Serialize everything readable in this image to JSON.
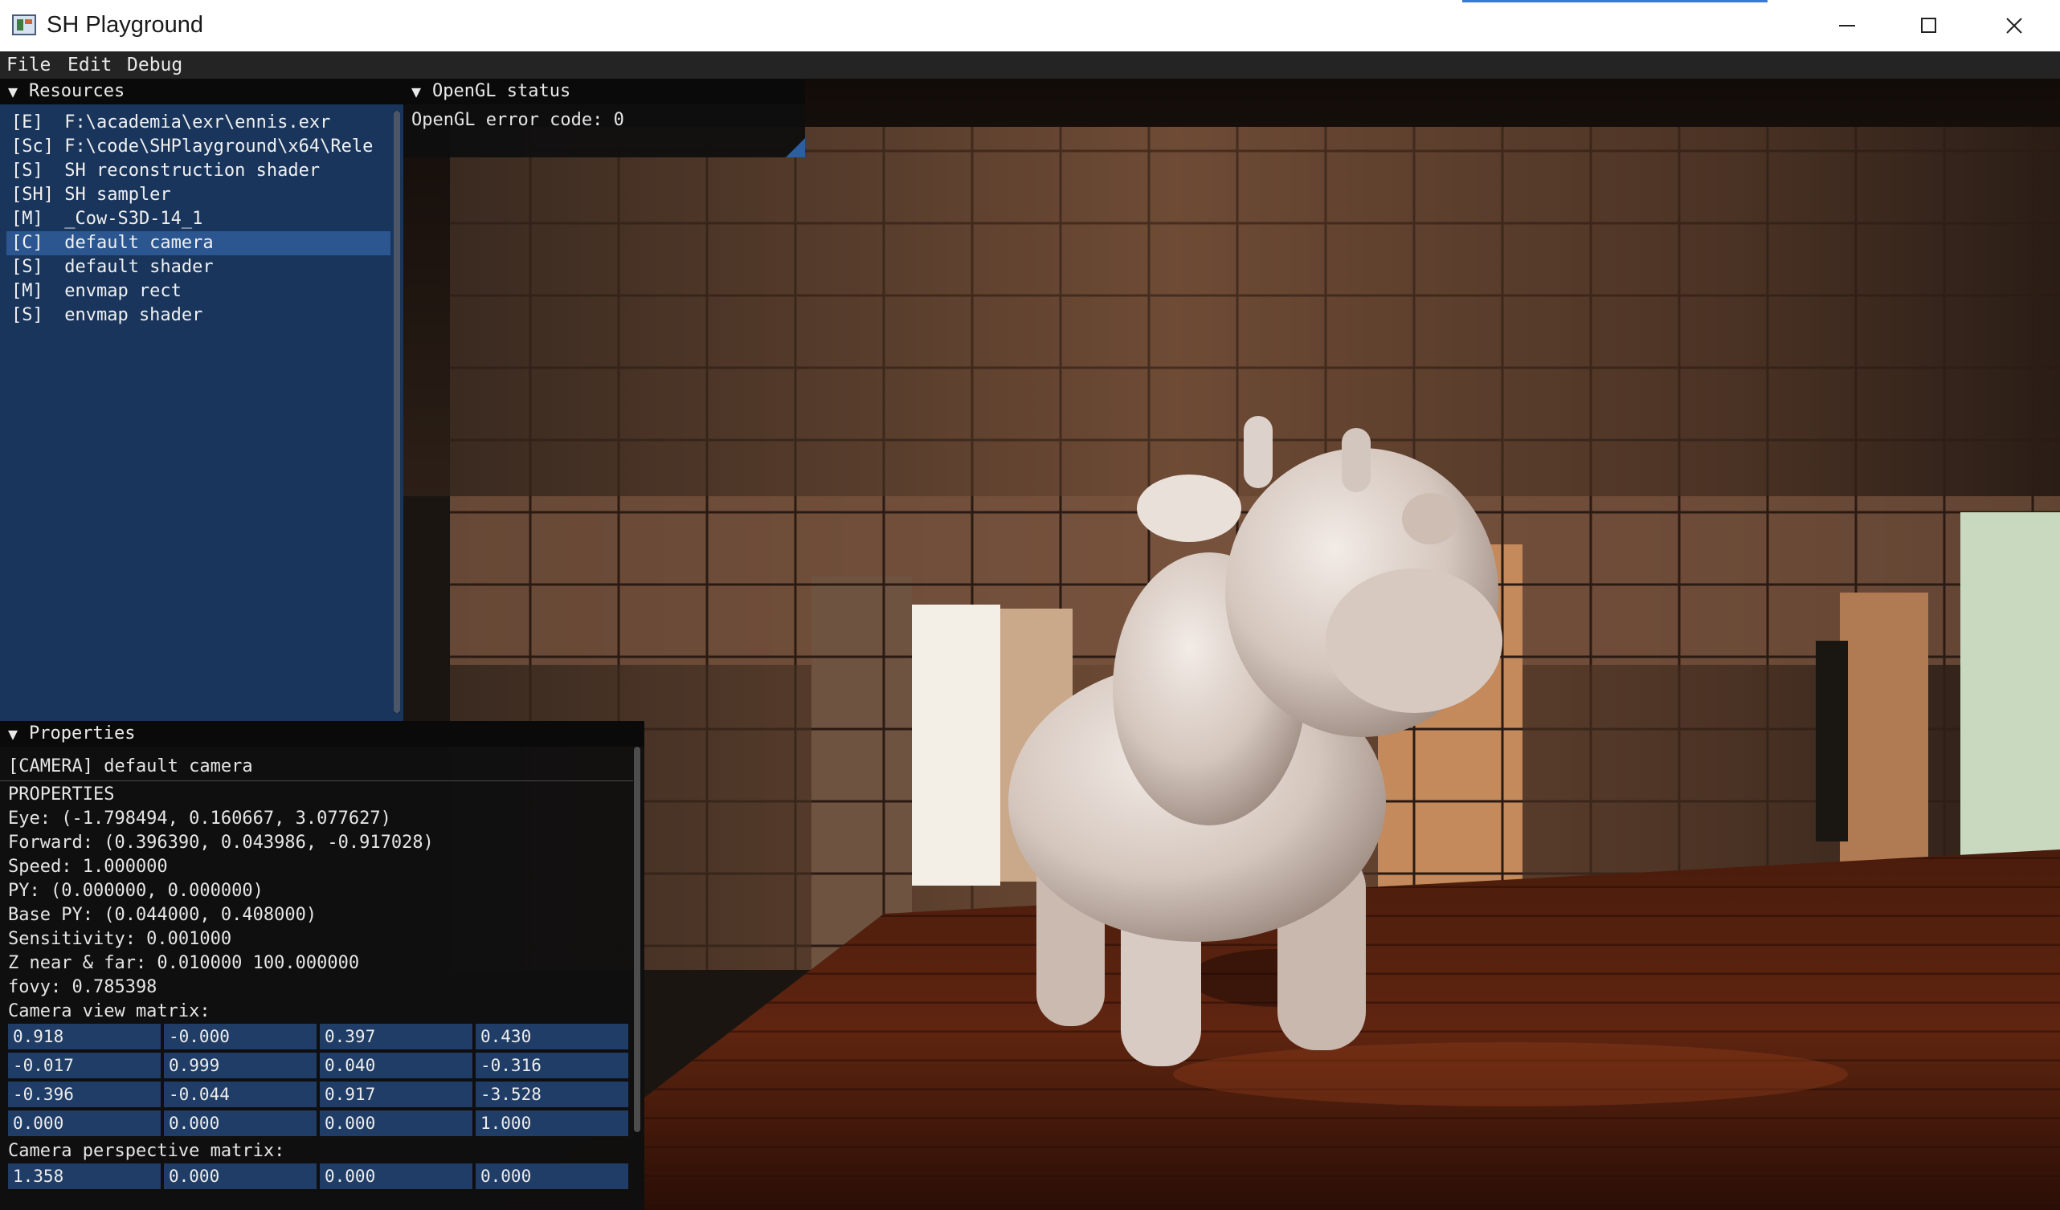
{
  "window": {
    "title": "SH Playground",
    "icon": "app-icon"
  },
  "menu": [
    "File",
    "Edit",
    "Debug"
  ],
  "resources": {
    "title": "Resources",
    "items": [
      "[E]  F:\\academia\\exr\\ennis.exr",
      "[Sc] F:\\code\\SHPlayground\\x64\\Rele",
      "[S]  SH reconstruction shader",
      "[SH] SH sampler",
      "[M]  _Cow-S3D-14_1",
      "[C]  default camera",
      "[S]  default shader",
      "[M]  envmap rect",
      "[S]  envmap shader"
    ],
    "selected_index": 5
  },
  "opengl": {
    "title": "OpenGL status",
    "error_line": "OpenGL error code: 0"
  },
  "properties": {
    "title": "Properties",
    "header": "[CAMERA] default camera",
    "section": "PROPERTIES",
    "lines": [
      "Eye: (-1.798494, 0.160667, 3.077627)",
      "Forward: (0.396390, 0.043986, -0.917028)",
      "Speed: 1.000000",
      "PY: (0.000000, 0.000000)",
      "Base PY: (0.044000, 0.408000)",
      "Sensitivity: 0.001000",
      "Z near & far: 0.010000 100.000000",
      "fovy: 0.785398"
    ],
    "view_label": "Camera view matrix:",
    "view_matrix": [
      [
        "0.918",
        "-0.000",
        "0.397",
        "0.430"
      ],
      [
        "-0.017",
        "0.999",
        "0.040",
        "-0.316"
      ],
      [
        "-0.396",
        "-0.044",
        "0.917",
        "-3.528"
      ],
      [
        "0.000",
        "0.000",
        "0.000",
        "1.000"
      ]
    ],
    "persp_label": "Camera perspective matrix:",
    "persp_matrix": [
      [
        "1.358",
        "0.000",
        "0.000",
        "0.000"
      ]
    ]
  },
  "colors": {
    "resources_bg": "#19355b",
    "selection": "#2c5690",
    "matrix_cell": "#1f3d66"
  }
}
